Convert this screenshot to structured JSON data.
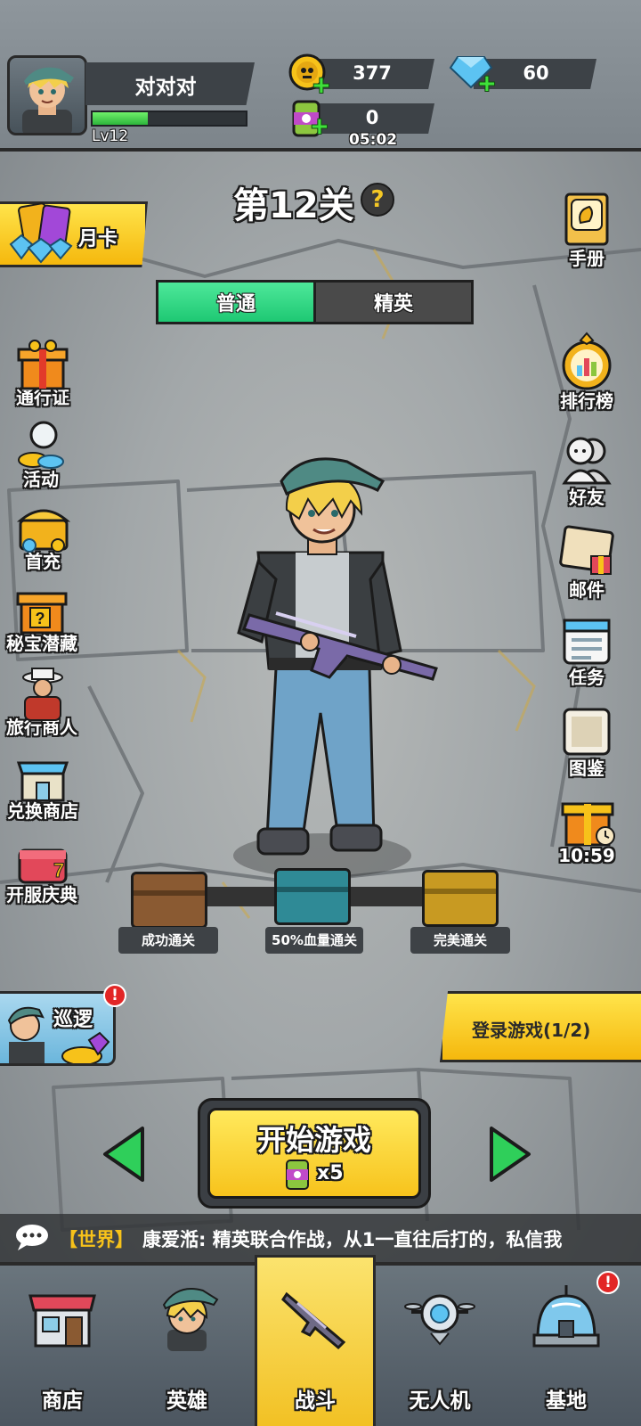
{
  "player": {
    "name": "对对对",
    "level": "Lv12",
    "xp_progress": 0.36
  },
  "resources": {
    "gold": "377",
    "gems": "60",
    "energy": "0",
    "energy_timer": "05:02"
  },
  "stage": {
    "title": "第12关",
    "help": "?"
  },
  "difficulty_tabs": [
    {
      "label": "普通",
      "active": true
    },
    {
      "label": "精英",
      "active": false
    }
  ],
  "month_card": {
    "label": "月卡"
  },
  "left_menu": [
    {
      "label": "通行证",
      "icon": "gift-box-icon"
    },
    {
      "label": "活动",
      "icon": "activity-coins-icon"
    },
    {
      "label": "首充",
      "icon": "treasure-chest-icon"
    },
    {
      "label": "秘宝潜藏",
      "icon": "mystery-gift-icon"
    },
    {
      "label": "旅行商人",
      "icon": "merchant-icon"
    },
    {
      "label": "兑换商店",
      "icon": "shop-icon"
    },
    {
      "label": "开服庆典",
      "icon": "celebration-chest-icon"
    }
  ],
  "right_menu": [
    {
      "label": "手册",
      "icon": "manual-book-icon"
    },
    {
      "label": "排行榜",
      "icon": "leaderboard-icon"
    },
    {
      "label": "好友",
      "icon": "friends-icon"
    },
    {
      "label": "邮件",
      "icon": "mail-icon"
    },
    {
      "label": "任务",
      "icon": "task-calendar-icon"
    },
    {
      "label": "图鉴",
      "icon": "codex-icon"
    },
    {
      "label": "10:59",
      "icon": "timed-gift-icon"
    }
  ],
  "reward_chests": [
    {
      "label": "成功通关",
      "color": "#8a5a32"
    },
    {
      "label": "50%血量通关",
      "color": "#2f8a96"
    },
    {
      "label": "完美通关",
      "color": "#c89a22"
    }
  ],
  "patrol": {
    "label": "巡逻",
    "badge": "!"
  },
  "login_task": {
    "label": "登录游戏(1/2)"
  },
  "start_button": {
    "label": "开始游戏",
    "cost": "x5"
  },
  "chat": {
    "channel": "【世界】",
    "message": "康爱湉: 精英联合作战，从1一直往后打的，私信我"
  },
  "bottom_nav": [
    {
      "label": "商店",
      "icon": "store-icon",
      "active": false
    },
    {
      "label": "英雄",
      "icon": "hero-icon",
      "active": false
    },
    {
      "label": "战斗",
      "icon": "rifle-icon",
      "active": true
    },
    {
      "label": "无人机",
      "icon": "drone-icon",
      "active": false
    },
    {
      "label": "基地",
      "icon": "base-dome-icon",
      "active": false,
      "badge": "!"
    }
  ],
  "colors": {
    "accent_yellow": "#f7c31c",
    "tab_green": "#1ec873",
    "badge_red": "#e22626",
    "chat_channel": "#f7c21a"
  }
}
